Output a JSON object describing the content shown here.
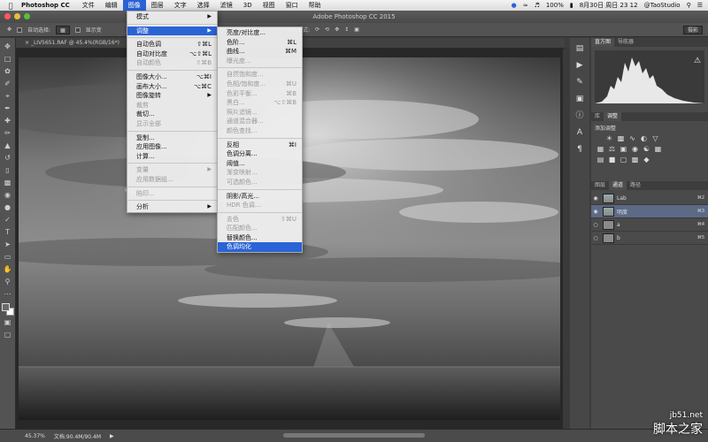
{
  "menubar": {
    "app": "Photoshop CC",
    "items": [
      "文件",
      "编辑",
      "图像",
      "图层",
      "文字",
      "选择",
      "滤镜",
      "3D",
      "视图",
      "窗口",
      "帮助"
    ],
    "active_index": 2,
    "battery": "100%",
    "datetime": "8月30日 周日  23 12",
    "user": "@TaoStudio"
  },
  "window": {
    "title": "Adobe Photoshop CC 2015"
  },
  "options": {
    "auto_select": "自动选择:",
    "show_transform": "显示变",
    "mode_3d": "3D 模式:",
    "workspace": "摄影"
  },
  "document": {
    "tab": "_LIV5651.RAF @ 45.4%(RGB/16*)"
  },
  "status": {
    "zoom": "45.37%",
    "doc_size": "文档:90.4M/90.4M"
  },
  "image_menu": {
    "items": [
      {
        "label": "模式",
        "shortcut": "",
        "submenu": true,
        "disabled": false
      },
      {
        "sep": true
      },
      {
        "label": "调整",
        "shortcut": "",
        "submenu": true,
        "disabled": false,
        "highlight": true
      },
      {
        "sep": true
      },
      {
        "label": "自动色调",
        "shortcut": "⇧⌘L",
        "disabled": false
      },
      {
        "label": "自动对比度",
        "shortcut": "⌥⇧⌘L",
        "disabled": false
      },
      {
        "label": "自动颜色",
        "shortcut": "⇧⌘B",
        "disabled": true
      },
      {
        "sep": true
      },
      {
        "label": "图像大小...",
        "shortcut": "⌥⌘I",
        "disabled": false
      },
      {
        "label": "画布大小...",
        "shortcut": "⌥⌘C",
        "disabled": false
      },
      {
        "label": "图像旋转",
        "shortcut": "",
        "submenu": true,
        "disabled": false
      },
      {
        "label": "裁剪",
        "shortcut": "",
        "disabled": true
      },
      {
        "label": "裁切...",
        "shortcut": "",
        "disabled": false
      },
      {
        "label": "显示全部",
        "shortcut": "",
        "disabled": true
      },
      {
        "sep": true
      },
      {
        "label": "复制...",
        "shortcut": "",
        "disabled": false
      },
      {
        "label": "应用图像...",
        "shortcut": "",
        "disabled": false
      },
      {
        "label": "计算...",
        "shortcut": "",
        "disabled": false
      },
      {
        "sep": true
      },
      {
        "label": "变量",
        "shortcut": "",
        "submenu": true,
        "disabled": true
      },
      {
        "label": "应用数据组...",
        "shortcut": "",
        "disabled": true
      },
      {
        "sep": true
      },
      {
        "label": "陷印...",
        "shortcut": "",
        "disabled": true
      },
      {
        "sep": true
      },
      {
        "label": "分析",
        "shortcut": "",
        "submenu": true,
        "disabled": false
      }
    ]
  },
  "adjust_menu": {
    "items": [
      {
        "label": "亮度/对比度...",
        "shortcut": "",
        "disabled": false
      },
      {
        "label": "色阶...",
        "shortcut": "⌘L",
        "disabled": false
      },
      {
        "label": "曲线...",
        "shortcut": "⌘M",
        "disabled": false
      },
      {
        "label": "曝光度...",
        "shortcut": "",
        "disabled": true
      },
      {
        "sep": true
      },
      {
        "label": "自然饱和度...",
        "shortcut": "",
        "disabled": true
      },
      {
        "label": "色相/饱和度...",
        "shortcut": "⌘U",
        "disabled": true
      },
      {
        "label": "色彩平衡...",
        "shortcut": "⌘B",
        "disabled": true
      },
      {
        "label": "黑白...",
        "shortcut": "⌥⇧⌘B",
        "disabled": true
      },
      {
        "label": "照片滤镜...",
        "shortcut": "",
        "disabled": true
      },
      {
        "label": "通道混合器...",
        "shortcut": "",
        "disabled": true
      },
      {
        "label": "颜色查找...",
        "shortcut": "",
        "disabled": true
      },
      {
        "sep": true
      },
      {
        "label": "反相",
        "shortcut": "⌘I",
        "disabled": false
      },
      {
        "label": "色调分离...",
        "shortcut": "",
        "disabled": false
      },
      {
        "label": "阈值...",
        "shortcut": "",
        "disabled": false
      },
      {
        "label": "渐变映射...",
        "shortcut": "",
        "disabled": true
      },
      {
        "label": "可选颜色...",
        "shortcut": "",
        "disabled": true
      },
      {
        "sep": true
      },
      {
        "label": "阴影/高光...",
        "shortcut": "",
        "disabled": false
      },
      {
        "label": "HDR 色调...",
        "shortcut": "",
        "disabled": true
      },
      {
        "sep": true
      },
      {
        "label": "去色",
        "shortcut": "⇧⌘U",
        "disabled": true
      },
      {
        "label": "匹配颜色...",
        "shortcut": "",
        "disabled": true
      },
      {
        "label": "替换颜色...",
        "shortcut": "",
        "disabled": false
      },
      {
        "label": "色调均化",
        "shortcut": "",
        "disabled": false,
        "highlight": true
      }
    ]
  },
  "panels": {
    "top_tabs": [
      "直方图",
      "导航器"
    ],
    "mid_tabs": [
      "库",
      "调整"
    ],
    "adjust_title": "添加调整",
    "bottom_tabs": [
      "图层",
      "通道",
      "路径"
    ],
    "channels": [
      {
        "name": "Lab",
        "shortcut": "⌘2",
        "selected": false
      },
      {
        "name": "明度",
        "shortcut": "⌘3",
        "selected": true
      },
      {
        "name": "a",
        "shortcut": "⌘4",
        "selected": false
      },
      {
        "name": "b",
        "shortcut": "⌘5",
        "selected": false
      }
    ]
  },
  "watermark": {
    "site": "jb51.net",
    "brand": "脚本之家"
  }
}
